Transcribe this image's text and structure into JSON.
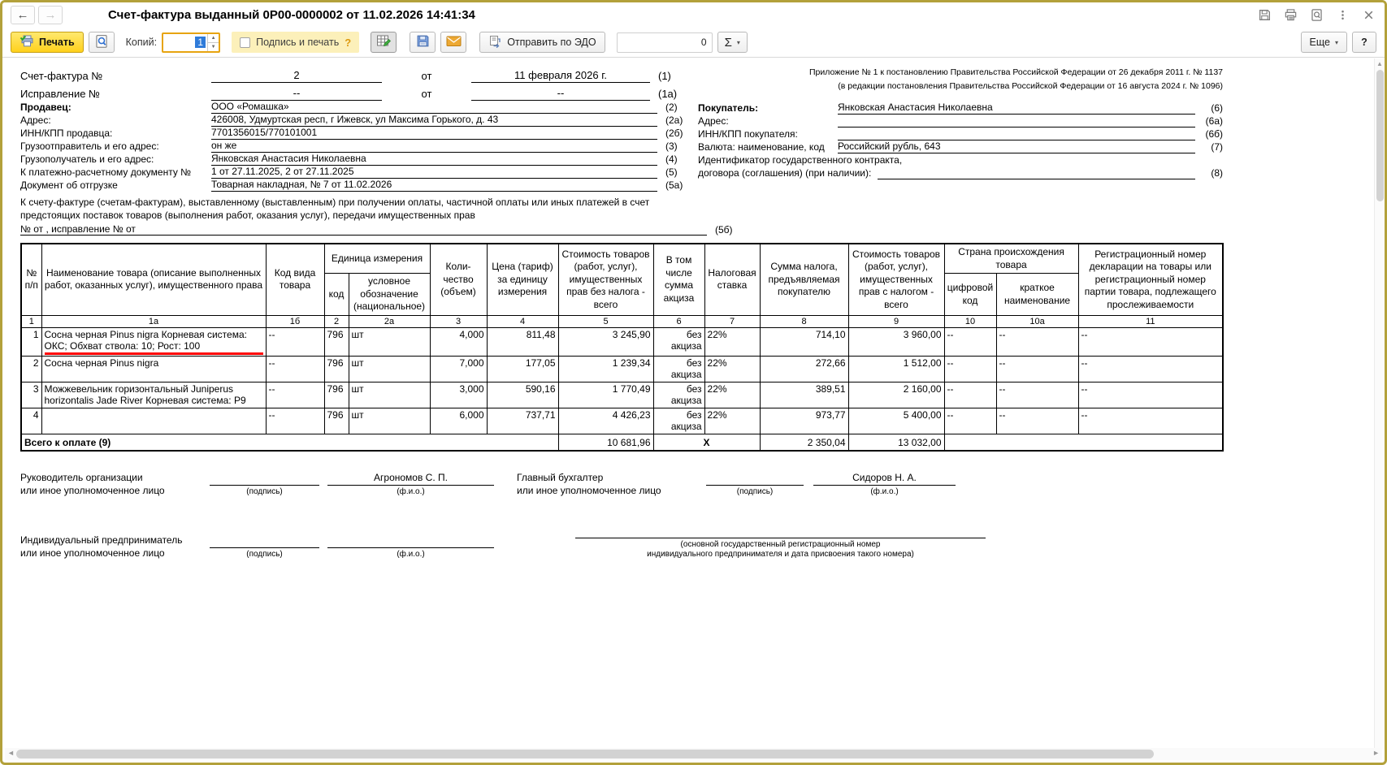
{
  "colors": {
    "window_border": "#b3a13b",
    "print_button_yellow": "#ffd11c",
    "focus_orange": "#e7a410",
    "highlight_yellow_bg": "#fcf0ba",
    "selection_blue": "#2f7bd9",
    "envelope_orange": "#eda934",
    "red_underline": "#ff0000"
  },
  "icons": {
    "arrow_left": "←",
    "arrow_right": "→",
    "caret_down": "▾",
    "spin_up": "▲",
    "spin_down": "▼",
    "scroll_up": "▲",
    "scroll_left": "◄",
    "scroll_right": "►",
    "names": [
      "save-icon",
      "printer-icon",
      "preview-icon",
      "kebab-menu-icon",
      "close-icon",
      "print-check-icon",
      "magnifier-page-icon",
      "table-edit-icon",
      "floppy-icon",
      "envelope-icon",
      "edo-send-icon",
      "sigma-icon"
    ]
  },
  "titlebar": {
    "title": "Счет-фактура выданный 0Р00-0000002 от 11.02.2026 14:41:34"
  },
  "toolbar": {
    "print_label": "Печать",
    "copies_label": "Копий:",
    "copies_value": "1",
    "sign_print_label": "Подпись и печать",
    "sign_print_hint": "?",
    "send_edo_label": "Отправить по ЭДО",
    "counter_value": "0",
    "sigma_label": "Σ",
    "more_label": "Еще",
    "help_label": "?"
  },
  "form": {
    "appendix_line1": "Приложение № 1 к постановлению Правительства Российской Федерации от 26 декабря 2011 г. № 1137",
    "appendix_line2": "(в редакции постановления Правительства Российской Федерации от 16 августа 2024 г. № 1096)",
    "invoice_label": "Счет-фактура №",
    "invoice_no": "2",
    "from_word": "от",
    "invoice_date": "11 февраля 2026 г.",
    "ref_1": "(1)",
    "correction_label": "Исправление №",
    "correction_no": "--",
    "correction_date": "--",
    "ref_1a": "(1а)",
    "seller_rows": [
      {
        "label": "Продавец:",
        "value": "ООО «Ромашка»",
        "ref": "(2)",
        "bold": true
      },
      {
        "label": "Адрес:",
        "value": "426008, Удмуртская респ, г Ижевск, ул Максима Горького, д. 43",
        "ref": "(2а)"
      },
      {
        "label": "ИНН/КПП продавца:",
        "value": "7701356015/770101001",
        "ref": "(2б)"
      },
      {
        "label": "Грузоотправитель и его адрес:",
        "value": "он же",
        "ref": "(3)"
      },
      {
        "label": "Грузополучатель и его адрес:",
        "value": "Янковская Анастасия Николаевна",
        "ref": "(4)"
      },
      {
        "label": "К платежно-расчетному документу №",
        "value": "1 от 27.11.2025, 2 от 27.11.2025",
        "ref": "(5)"
      },
      {
        "label": "Документ об отгрузке",
        "value": "Товарная накладная, № 7 от 11.02.2026",
        "ref": "(5а)"
      }
    ],
    "buyer_rows": [
      {
        "label": "Покупатель:",
        "value": "Янковская Анастасия Николаевна",
        "ref": "(6)",
        "bold": true
      },
      {
        "label": "Адрес:",
        "value": "",
        "ref": "(6а)"
      },
      {
        "label": "ИНН/КПП покупателя:",
        "value": "",
        "ref": "(6б)"
      },
      {
        "label": "Валюта: наименование, код",
        "value": "Российский рубль, 643",
        "ref": "(7)"
      }
    ],
    "contract_label_line1": "Идентификатор государственного контракта,",
    "contract_label_line2": "договора (соглашения) (при наличии):",
    "contract_value": "",
    "ref_8": "(8)",
    "note_line1": "К счету-фактуре (счетам-фактурам), выставленному (выставленным) при получении оплаты, частичной оплаты или иных платежей в счет",
    "note_line2": "предстоящих поставок товаров (выполнения работ, оказания услуг), передачи имущественных прав",
    "note_numbers": "№   от   , исправление №   от",
    "ref_5b": "(5б)"
  },
  "table": {
    "headers": {
      "num": "№\nп/п",
      "name": "Наименование товара (описание выполненных работ, оказанных услуг), имущественного права",
      "kind": "Код вида товара",
      "unit_group": "Единица измерения",
      "unit_code": "код",
      "unit_name": "условное обозначение (национальное)",
      "qty": "Коли-чество (объем)",
      "price": "Цена (тариф) за единицу измерения",
      "amount": "Стоимость товаров (работ, услуг), имущественных прав без налога - всего",
      "excise": "В том числе сумма акциза",
      "rate": "Налоговая ставка",
      "vat": "Сумма налога, предъявляемая покупателю",
      "total": "Стоимость товаров (работ, услуг), имущественных прав с налогом - всего",
      "country_group": "Страна происхождения товара",
      "country_code": "цифровой код",
      "country_name": "краткое наименование",
      "reg": "Регистрационный номер декларации на товары или регистрационный номер партии товара, подлежащего прослеживаемости"
    },
    "col_numbers": [
      "1",
      "1а",
      "1б",
      "2",
      "2а",
      "3",
      "4",
      "5",
      "6",
      "7",
      "8",
      "9",
      "10",
      "10а",
      "11"
    ],
    "aligns": [
      "r",
      "l",
      "l",
      "l",
      "l",
      "r",
      "r",
      "r",
      "r",
      "l",
      "r",
      "r",
      "l",
      "l",
      "l"
    ],
    "rows": [
      {
        "redline": true,
        "cells": [
          "1",
          "Сосна черная Pinus nigra Корневая система:\nОКС; Обхват ствола: 10; Рост: 100",
          "--",
          "796",
          "шт",
          "4,000",
          "811,48",
          "3 245,90",
          "без акциза",
          "22%",
          "714,10",
          "3 960,00",
          "--",
          "--",
          "--"
        ]
      },
      {
        "cells": [
          "2",
          "Сосна черная Pinus nigra",
          "--",
          "796",
          "шт",
          "7,000",
          "177,05",
          "1 239,34",
          "без акциза",
          "22%",
          "272,66",
          "1 512,00",
          "--",
          "--",
          "--"
        ]
      },
      {
        "cells": [
          "3",
          "Можжевельник горизонтальный Juniperus horizontalis Jade River  Корневая система: P9",
          "--",
          "796",
          "шт",
          "3,000",
          "590,16",
          "1 770,49",
          "без акциза",
          "22%",
          "389,51",
          "2 160,00",
          "--",
          "--",
          "--"
        ]
      },
      {
        "cells": [
          "4",
          "",
          "--",
          "796",
          "шт",
          "6,000",
          "737,71",
          "4 426,23",
          "без акциза",
          "22%",
          "973,77",
          "5 400,00",
          "--",
          "--",
          "--"
        ]
      }
    ],
    "total": {
      "label": "Всего к оплате (9)",
      "amount": "10 681,96",
      "x_mark": "X",
      "vat": "2 350,04",
      "total": "13 032,00"
    }
  },
  "signatures": {
    "director_label": "Руководитель организации\nили иное уполномоченное лицо",
    "sign_caption": "(подпись)",
    "fio_caption": "(ф.и.о.)",
    "director_name": "Агрономов С. П.",
    "accountant_label": "Главный бухгалтер\nили иное уполномоченное лицо",
    "accountant_name": "Сидоров Н. А.",
    "entrepreneur_label": "Индивидуальный предприниматель\nили иное уполномоченное лицо",
    "ogrn_caption": "(основной государственный регистрационный номер\nиндивидуального предпринимателя и дата присвоения такого номера)"
  }
}
